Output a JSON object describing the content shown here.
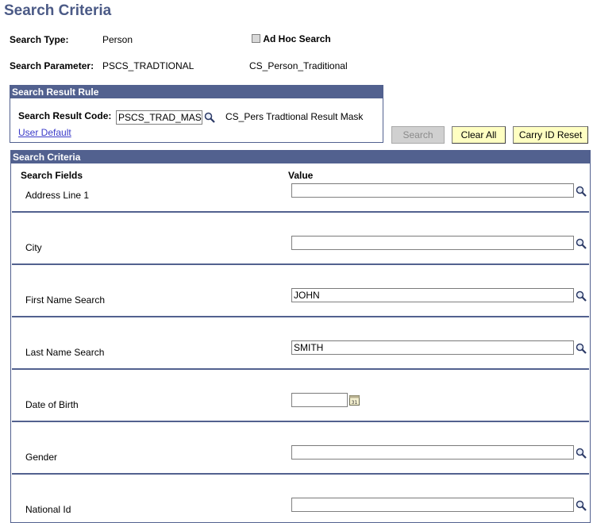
{
  "page": {
    "title": "Search Criteria"
  },
  "search_type": {
    "label": "Search Type:",
    "value": "Person"
  },
  "ad_hoc": {
    "label": "Ad Hoc Search",
    "checked": false
  },
  "search_parameter": {
    "label": "Search Parameter:",
    "value": "PSCS_TRADTIONAL",
    "description": "CS_Person_Traditional"
  },
  "result_rule": {
    "header": "Search Result Rule",
    "code_label": "Search Result Code:",
    "code_value": "PSCS_TRAD_MASK",
    "code_description": "CS_Pers Tradtional Result Mask",
    "user_default_link": "User Default"
  },
  "buttons": {
    "search": "Search",
    "clear_all": "Clear All",
    "carry_id_reset": "Carry ID Reset"
  },
  "criteria": {
    "header": "Search Criteria",
    "col_fields": "Search Fields",
    "col_value": "Value",
    "rows": [
      {
        "label": "Address Line 1",
        "value": "",
        "icon": "search-icon"
      },
      {
        "label": "City",
        "value": "",
        "icon": "search-icon"
      },
      {
        "label": "First Name Search",
        "value": "JOHN",
        "icon": "search-icon"
      },
      {
        "label": "Last Name Search",
        "value": "SMITH",
        "icon": "search-icon"
      },
      {
        "label": "Date of Birth",
        "value": "",
        "icon": "calendar-icon"
      },
      {
        "label": "Gender",
        "value": "",
        "icon": "search-icon"
      },
      {
        "label": "National Id",
        "value": "",
        "icon": "search-icon"
      }
    ]
  },
  "colors": {
    "header_bg": "#52618f",
    "title": "#4b5a86",
    "button_bg": "#ffffc2",
    "link": "#3a3ac8"
  }
}
